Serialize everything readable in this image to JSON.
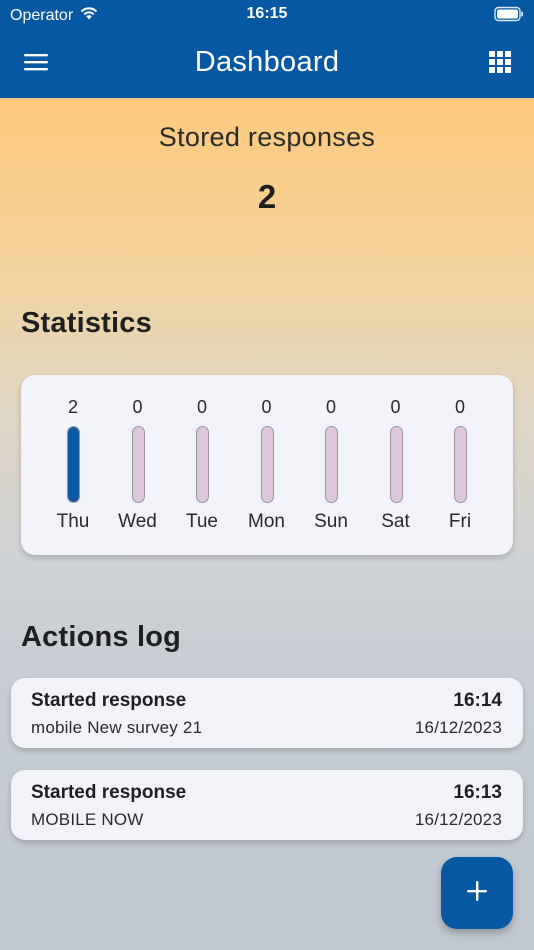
{
  "status_bar": {
    "carrier": "Operator",
    "time": "16:15",
    "icons": [
      "wifi-icon",
      "battery-icon"
    ]
  },
  "app_bar": {
    "title": "Dashboard",
    "menu_icon": "hamburger-menu-icon",
    "apps_icon": "grid-apps-icon"
  },
  "stored": {
    "title": "Stored responses",
    "value": "2"
  },
  "statistics": {
    "heading": "Statistics",
    "days": [
      {
        "label": "Thu",
        "count": "2",
        "fill": 1.0
      },
      {
        "label": "Wed",
        "count": "0",
        "fill": 0
      },
      {
        "label": "Tue",
        "count": "0",
        "fill": 0
      },
      {
        "label": "Mon",
        "count": "0",
        "fill": 0
      },
      {
        "label": "Sun",
        "count": "0",
        "fill": 0
      },
      {
        "label": "Sat",
        "count": "0",
        "fill": 0
      },
      {
        "label": "Fri",
        "count": "0",
        "fill": 0
      }
    ],
    "colors": {
      "filled": "#0b5aa6",
      "empty": "#dcc7dd"
    }
  },
  "actions_log": {
    "heading": "Actions log",
    "entries": [
      {
        "action": "Started response",
        "time": "16:14",
        "detail": "mobile New survey 21",
        "date": "16/12/2023"
      },
      {
        "action": "Started response",
        "time": "16:13",
        "detail": "MOBILE NOW",
        "date": "16/12/2023"
      }
    ]
  },
  "fab": {
    "icon": "plus-icon"
  },
  "colors": {
    "primary": "#0758a2",
    "header_gradient_top": "#fdc97d",
    "background_bottom": "#c1c7d0"
  }
}
